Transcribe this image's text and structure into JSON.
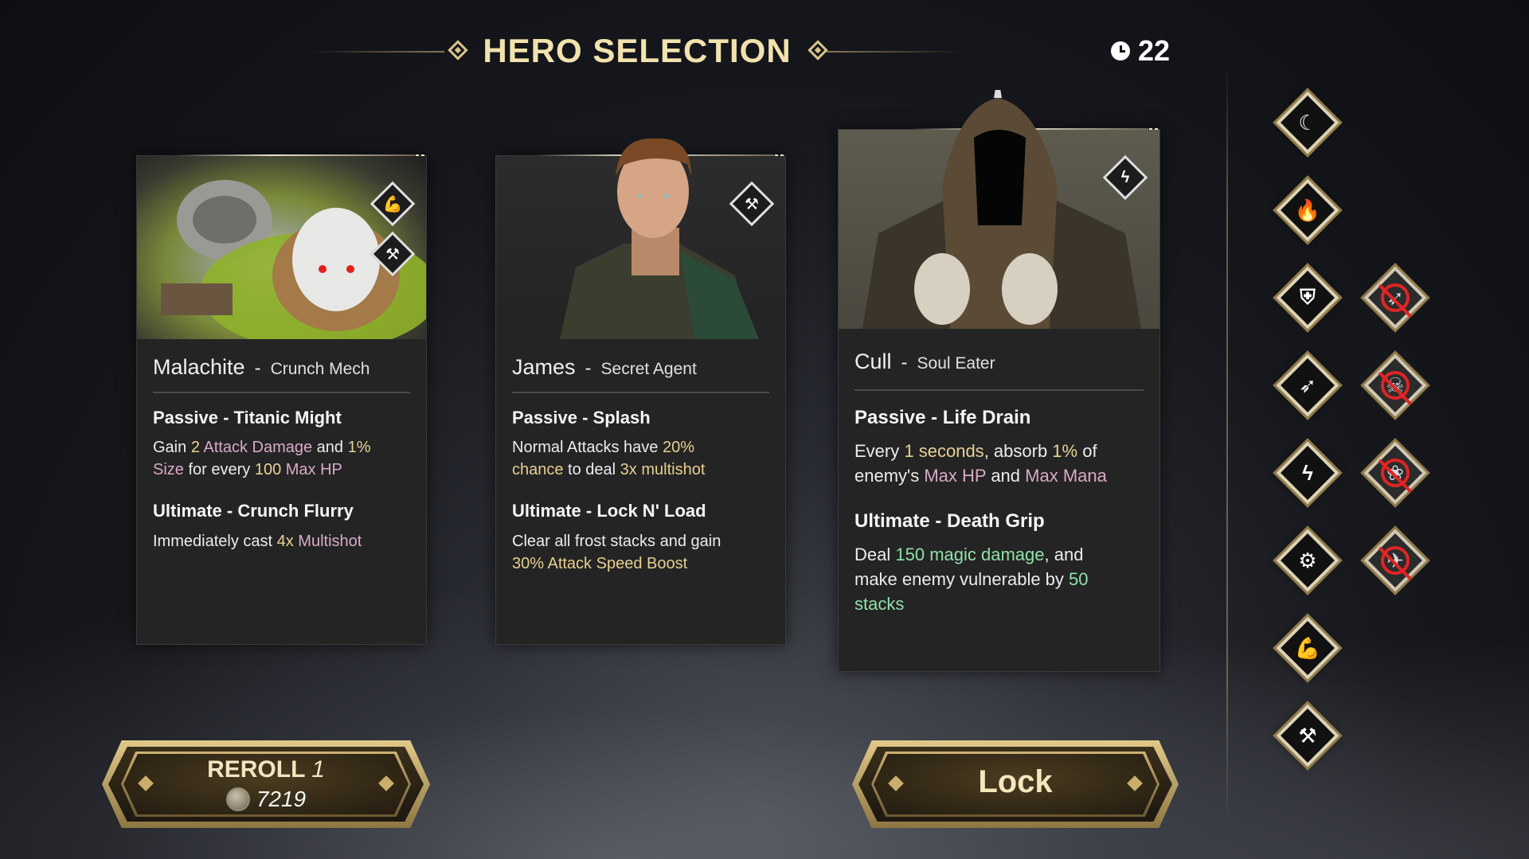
{
  "header": {
    "title": "HERO SELECTION",
    "timer": "22"
  },
  "cards": [
    {
      "name": "Malachite",
      "class": "Crunch Mech",
      "passive_title": "Passive  -  Titanic Might",
      "passive_parts": [
        "Gain ",
        "2",
        " ",
        "Attack Damage",
        " and ",
        "1%",
        "Size",
        " for every ",
        "100",
        " ",
        "Max HP"
      ],
      "ultimate_title": "Ultimate  -  Crunch Flurry",
      "ultimate_parts": [
        "Immediately cast ",
        "4x",
        " ",
        "Multishot"
      ],
      "tags": [
        "muscle-arm-icon",
        "crossed-hammers-icon"
      ]
    },
    {
      "name": "James",
      "class": "Secret Agent",
      "passive_title": "Passive  -  Splash",
      "passive_parts": [
        "Normal Attacks have ",
        "20%",
        "chance",
        " to deal ",
        "3x multishot"
      ],
      "ultimate_title": "Ultimate  -  Lock N' Load",
      "ultimate_parts": [
        "Clear all frost stacks and gain",
        "30% Attack Speed Boost"
      ],
      "tags": [
        "crossed-hammers-icon"
      ]
    },
    {
      "name": "Cull",
      "class": "Soul Eater",
      "passive_title": "Passive  -  Life Drain",
      "passive_parts": [
        "Every ",
        "1",
        " ",
        "seconds",
        ", absorb ",
        "1%",
        " of",
        "enemy's ",
        "Max HP",
        " and ",
        "Max Mana"
      ],
      "ultimate_title": "Ultimate  -  Death Grip",
      "ultimate_parts": [
        "Deal ",
        "150",
        " ",
        "magic damage",
        ", and",
        "make enemy vulnerable by ",
        "50",
        "stacks"
      ],
      "tags": [
        "lightning-icon"
      ]
    }
  ],
  "buttons": {
    "reroll_label": "REROLL",
    "reroll_count": "1",
    "reroll_cost": "7219",
    "lock_label": "Lock"
  },
  "side_icons": {
    "available": [
      "moon-blade-icon",
      "fire-icon",
      "shield-icon",
      "wing-icon",
      "lightning-icon",
      "gear-eye-icon",
      "muscle-arm-icon",
      "crossed-hammers-icon"
    ],
    "banned": [
      "banned-wing-icon",
      "banned-skull-icon",
      "banned-flower-icon",
      "banned-bird-icon"
    ]
  }
}
